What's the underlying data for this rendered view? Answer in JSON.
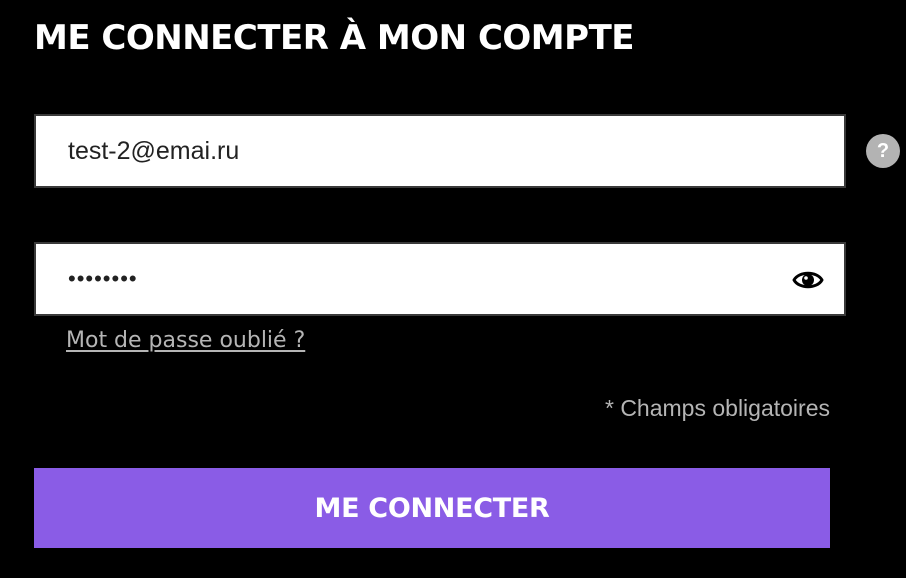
{
  "login": {
    "title": "ME CONNECTER À MON COMPTE",
    "email": {
      "value": "test-2@emai.ru"
    },
    "password": {
      "value": "xxxxxxxx",
      "masked_display": "••••••••"
    },
    "help_icon_text": "?",
    "forgot_password_label": "Mot de passe oublié ?",
    "required_note": "* Champs obligatoires",
    "submit_label": "ME CONNECTER"
  },
  "icons": {
    "help": "question-circle-icon",
    "password_toggle": "eye-icon"
  },
  "colors": {
    "background": "#000000",
    "accent": "#8a5ce6",
    "field_background": "#ffffff",
    "muted_text": "#b5b5b5",
    "help_icon": "#b3b3b3"
  }
}
